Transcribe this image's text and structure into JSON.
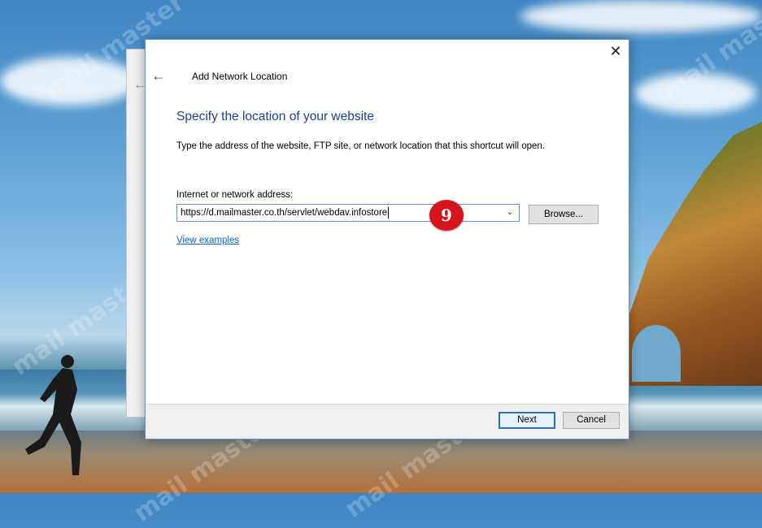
{
  "window": {
    "title": "Add Network Location",
    "close_symbol": "✕",
    "back_symbol": "←"
  },
  "page": {
    "heading": "Specify the location of your website",
    "instruction": "Type the address of the website, FTP site, or network location that this shortcut will open.",
    "field_label": "Internet or network address:",
    "address_value": "https://d.mailmaster.co.th/servlet/webdav.infostore",
    "browse_label": "Browse...",
    "view_examples_label": "View examples"
  },
  "annotation": {
    "step_number": "9"
  },
  "footer": {
    "next_label": "Next",
    "cancel_label": "Cancel"
  },
  "watermark": {
    "text": "mail master"
  },
  "colors": {
    "heading": "#1e3f8f",
    "link": "#0066cc",
    "focus_border": "#2c6cc7",
    "badge": "#d7151b"
  }
}
